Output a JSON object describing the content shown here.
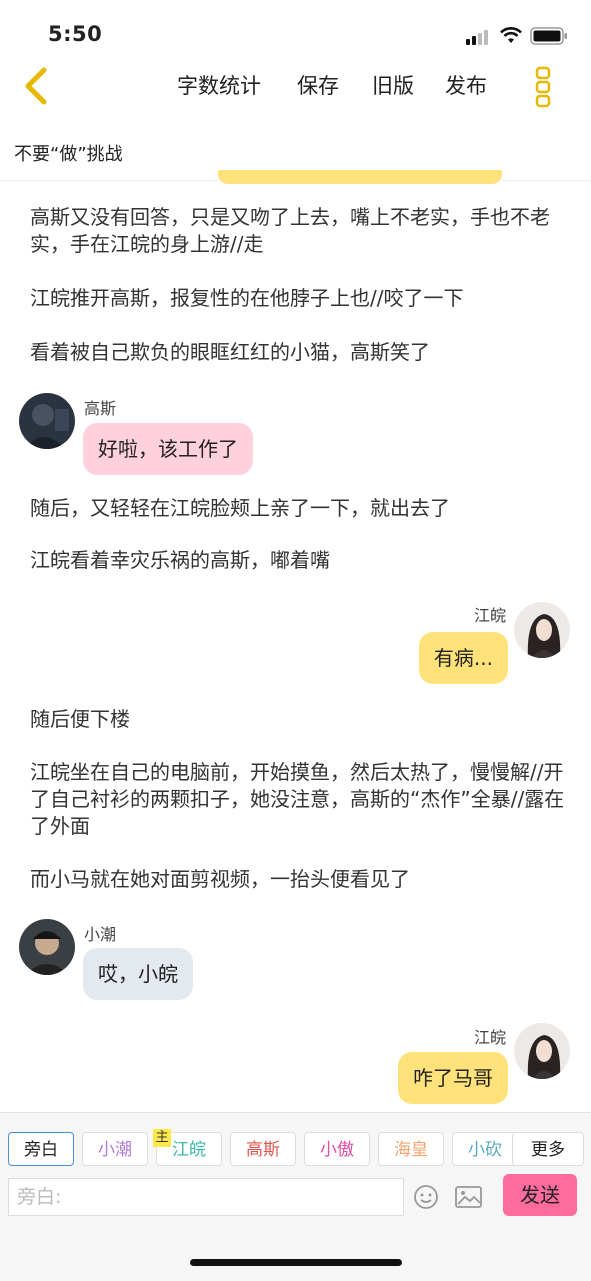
{
  "status_bar": {
    "time": "5:50"
  },
  "nav": {
    "word_count": "字数统计",
    "save": "保存",
    "old_version": "旧版",
    "publish": "发布"
  },
  "story_title": "不要“做”挑战",
  "content": {
    "p1": "高斯又没有回答，只是又吻了上去，嘴上不老实，手也不老实，手在江皖的身上游//走",
    "p2": "江皖推开高斯，报复性的在他脖子上也//咬了一下",
    "p3": "看着被自己欺负的眼眶红红的小猫，高斯笑了",
    "msg1": {
      "name": "高斯",
      "text": "好啦，该工作了"
    },
    "p4": "随后，又轻轻在江皖脸颊上亲了一下，就出去了",
    "p5": "江皖看着幸灾乐祸的高斯，嘟着嘴",
    "msg2": {
      "name": "江皖",
      "text": "有病..."
    },
    "p6": "随后便下楼",
    "p7": "江皖坐在自己的电脑前，开始摸鱼，然后太热了，慢慢解//开了自己衬衫的两颗扣子，她没注意，高斯的“杰作”全暴//露在了外面",
    "p8": "而小马就在她对面剪视频，一抬头便看见了",
    "msg3": {
      "name": "小潮",
      "text": "哎，小皖"
    },
    "msg4": {
      "name": "江皖",
      "text": "咋了马哥"
    }
  },
  "characters": {
    "narrator": "旁白",
    "c1": "小潮",
    "c2": "江皖",
    "c2_badge": "主",
    "c3": "高斯",
    "c4": "小傲",
    "c5": "海皇",
    "c6": "小砍",
    "more": "更多"
  },
  "character_colors": {
    "c1": "#b07ad6",
    "c2": "#3bb8a6",
    "c3": "#e0554f",
    "c4": "#e04fa0",
    "c5": "#f0a470",
    "c6": "#5aa8c0"
  },
  "input": {
    "placeholder": "旁白:",
    "send": "发送"
  }
}
